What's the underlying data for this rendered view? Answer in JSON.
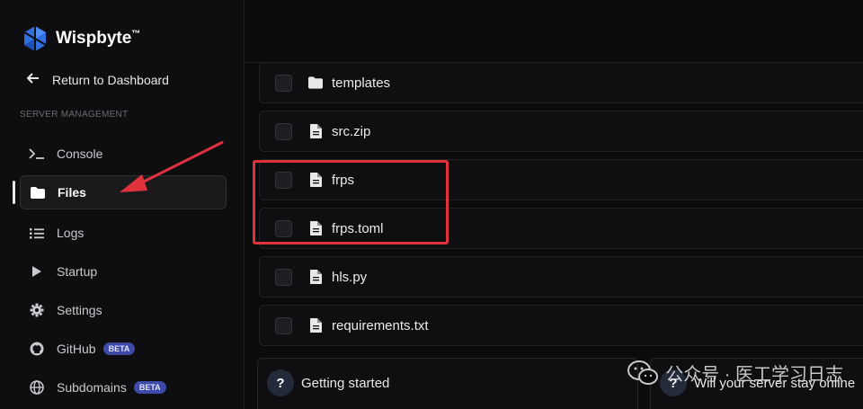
{
  "app": {
    "name": "Wispbyte",
    "trademark": "™"
  },
  "sidebar": {
    "back_label": "Return to Dashboard",
    "section_label": "SERVER MANAGEMENT",
    "items": [
      {
        "label": "Console",
        "icon": "terminal-icon"
      },
      {
        "label": "Files",
        "icon": "folder-icon",
        "active": true
      },
      {
        "label": "Logs",
        "icon": "list-icon"
      },
      {
        "label": "Startup",
        "icon": "play-icon"
      },
      {
        "label": "Settings",
        "icon": "gear-icon"
      },
      {
        "label": "GitHub",
        "icon": "github-icon",
        "badge": "BETA"
      },
      {
        "label": "Subdomains",
        "icon": "globe-icon",
        "badge": "BETA"
      }
    ]
  },
  "files": [
    {
      "name": "templates",
      "type": "folder"
    },
    {
      "name": "src.zip",
      "type": "file"
    },
    {
      "name": "frps",
      "type": "file"
    },
    {
      "name": "frps.toml",
      "type": "file"
    },
    {
      "name": "hls.py",
      "type": "file"
    },
    {
      "name": "requirements.txt",
      "type": "file"
    }
  ],
  "cards": [
    {
      "title": "Getting started"
    },
    {
      "title": "Will your server stay online"
    }
  ],
  "watermark": {
    "text": "公众号 · 医工学习日志"
  },
  "colors": {
    "accent": "#3d4aa8",
    "highlight": "#e0323c",
    "background": "#0b0b0c"
  }
}
